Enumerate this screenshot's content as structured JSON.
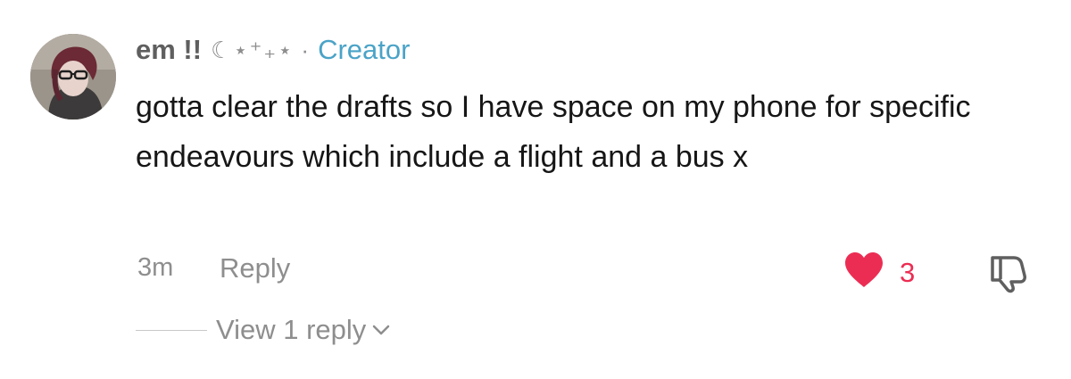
{
  "comment": {
    "author": {
      "name": "em !!",
      "decoration": "☾⋆⁺₊⋆",
      "separator": "·",
      "badge": "Creator"
    },
    "text": "gotta clear the drafts so I have space on my phone for specific endeavours which include a flight and a bus x",
    "timestamp": "3m",
    "reply_label": "Reply",
    "likes": {
      "count": "3",
      "liked": true
    },
    "view_replies_label": "View 1 reply"
  },
  "colors": {
    "text": "#161616",
    "muted": "#8e8e8e",
    "name": "#5f5f5f",
    "creator_badge": "#4aa3c7",
    "like": "#ec2d53"
  },
  "icons": {
    "like": "heart-icon",
    "dislike": "thumbs-down-icon",
    "expand": "chevron-down-icon"
  }
}
